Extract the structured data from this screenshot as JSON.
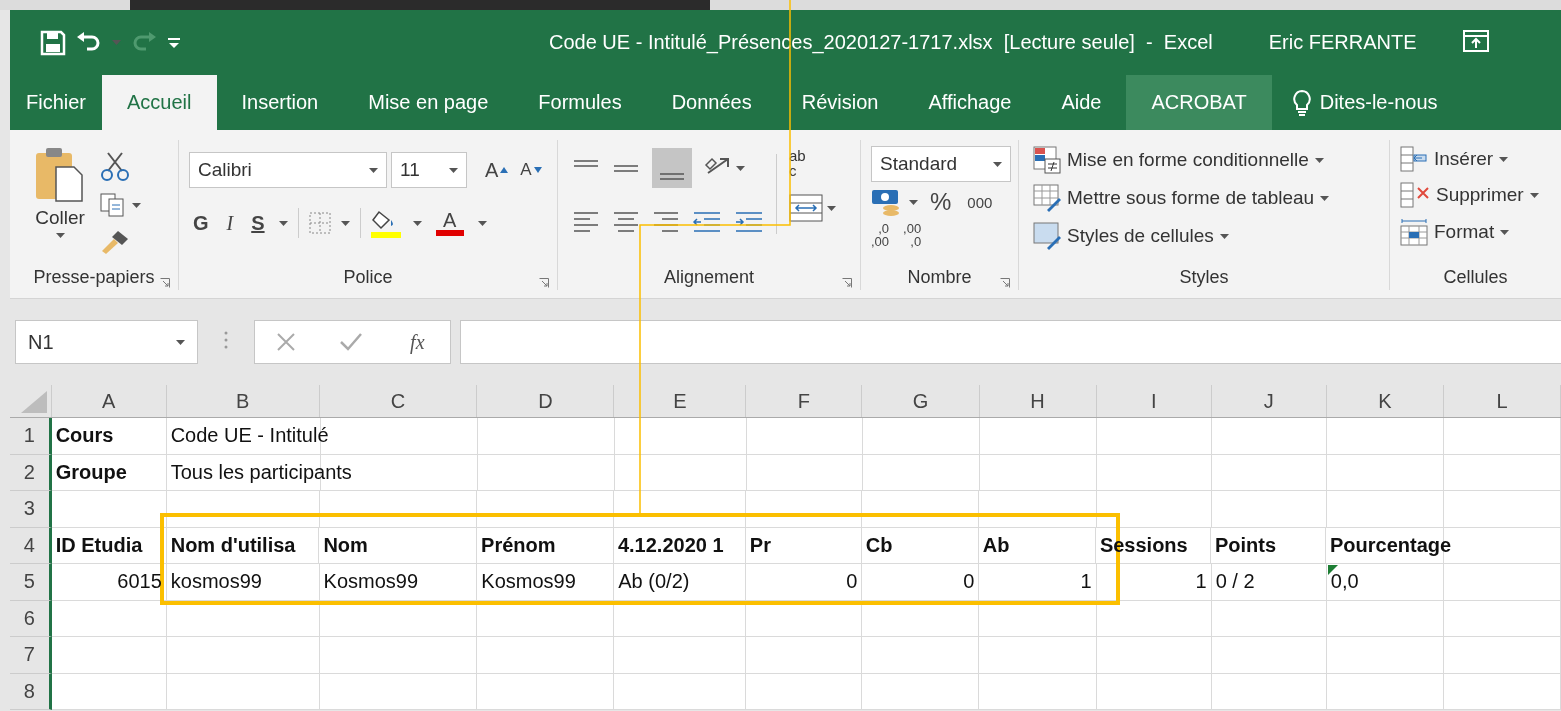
{
  "title_bar": {
    "title": "Code UE - Intitulé_Présences_2020127-1717.xlsx  [Lecture seule]  -  Excel",
    "user": "Eric FERRANTE"
  },
  "tabs": [
    {
      "label": "Fichier",
      "kind": "tab",
      "selected": false,
      "highlighted": false
    },
    {
      "label": "Accueil",
      "kind": "tab",
      "selected": true,
      "highlighted": false
    },
    {
      "label": "Insertion",
      "kind": "tab",
      "selected": false,
      "highlighted": false
    },
    {
      "label": "Mise en page",
      "kind": "tab",
      "selected": false,
      "highlighted": false
    },
    {
      "label": "Formules",
      "kind": "tab",
      "selected": false,
      "highlighted": false
    },
    {
      "label": "Données",
      "kind": "tab",
      "selected": false,
      "highlighted": false
    },
    {
      "label": "Révision",
      "kind": "tab",
      "selected": false,
      "highlighted": false
    },
    {
      "label": "Affichage",
      "kind": "tab",
      "selected": false,
      "highlighted": false
    },
    {
      "label": "Aide",
      "kind": "tab",
      "selected": false,
      "highlighted": false
    },
    {
      "label": "ACROBAT",
      "kind": "tab",
      "selected": false,
      "highlighted": true
    },
    {
      "label": "Dites-le-nous",
      "kind": "tell",
      "selected": false,
      "highlighted": false
    }
  ],
  "ribbon": {
    "clipboard": {
      "paste": "Coller",
      "label": "Presse-papiers"
    },
    "font": {
      "name": "Calibri",
      "size": "11",
      "grow": "A",
      "shrink": "A",
      "bold": "G",
      "italic": "I",
      "underline": "S",
      "font_color_letter": "A",
      "label": "Police"
    },
    "alignment": {
      "wrap_text": [
        "ab",
        "c"
      ],
      "label": "Alignement"
    },
    "number": {
      "format": "Standard",
      "percent": "%",
      "thousands": "000",
      "increase_decimal": [
        ",0",
        ",00"
      ],
      "decrease_decimal": [
        ",00",
        ",0"
      ],
      "label": "Nombre"
    },
    "styles": {
      "items": [
        "Mise en forme conditionnelle",
        "Mettre sous forme de tableau",
        "Styles de cellules"
      ],
      "label": "Styles"
    },
    "cells": {
      "items": [
        "Insérer",
        "Supprimer",
        "Format"
      ],
      "label": "Cellules"
    }
  },
  "formula_bar": {
    "name_box": "N1",
    "function_label": "fx"
  },
  "sheet": {
    "columns": [
      "A",
      "B",
      "C",
      "D",
      "E",
      "F",
      "G",
      "H",
      "I",
      "J",
      "K",
      "L"
    ],
    "rows": [
      {
        "number": "1",
        "cells": [
          {
            "text": "Cours",
            "kind": "label"
          },
          {
            "text": "Code UE - Intitulé",
            "kind": "text"
          }
        ]
      },
      {
        "number": "2",
        "cells": [
          {
            "text": "Groupe",
            "kind": "label"
          },
          {
            "text": "Tous les participants",
            "kind": "text"
          }
        ]
      },
      {
        "number": "3",
        "cells": []
      },
      {
        "number": "4",
        "cells": [
          {
            "text": "ID Etudia",
            "kind": "label"
          },
          {
            "text": "Nom d'utilisa",
            "kind": "label"
          },
          {
            "text": "Nom",
            "kind": "label"
          },
          {
            "text": "Prénom",
            "kind": "label"
          },
          {
            "text": "4.12.2020 1",
            "kind": "label"
          },
          {
            "text": "Pr",
            "kind": "label"
          },
          {
            "text": "Cb",
            "kind": "label"
          },
          {
            "text": "Ab",
            "kind": "label"
          },
          {
            "text": "Sessions",
            "kind": "label"
          },
          {
            "text": "Points",
            "kind": "label"
          },
          {
            "text": "Pourcentage",
            "kind": "label"
          }
        ]
      },
      {
        "number": "5",
        "cells": [
          {
            "text": "6015",
            "kind": "number"
          },
          {
            "text": "kosmos99",
            "kind": "text"
          },
          {
            "text": "Kosmos99",
            "kind": "text"
          },
          {
            "text": "Kosmos99",
            "kind": "text"
          },
          {
            "text": "Ab (0/2)",
            "kind": "text"
          },
          {
            "text": "0",
            "kind": "number"
          },
          {
            "text": "0",
            "kind": "number"
          },
          {
            "text": "1",
            "kind": "number"
          },
          {
            "text": "1",
            "kind": "number"
          },
          {
            "text": "0 / 2",
            "kind": "text"
          },
          {
            "text": "0,0",
            "kind": "text",
            "error_flag": true
          }
        ]
      },
      {
        "number": "6",
        "cells": []
      },
      {
        "number": "7",
        "cells": []
      },
      {
        "number": "8",
        "cells": []
      }
    ]
  }
}
